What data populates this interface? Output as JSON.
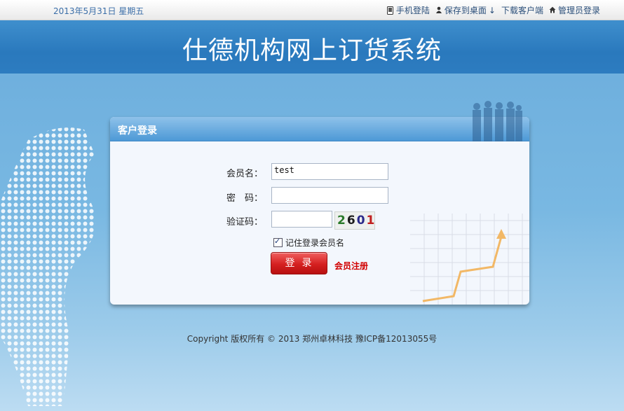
{
  "topbar": {
    "date": "2013年5月31日  星期五",
    "links": {
      "mobile": "手机登陆",
      "save_desktop": "保存到桌面",
      "download_client": "下载客户端",
      "admin_login": "管理员登录"
    }
  },
  "header": {
    "title": "仕德机构网上订货系统"
  },
  "login": {
    "panel_title": "客户登录",
    "username_label": "会员名：",
    "username_value": "test",
    "password_label": "密　码：",
    "password_value": "",
    "captcha_label": "验证码：",
    "captcha_value": "",
    "captcha_digits": [
      "2",
      "6",
      "0",
      "1"
    ],
    "captcha_colors": [
      "#2a7a2a",
      "#1a1a1a",
      "#2a2a8a",
      "#c02020"
    ],
    "remember_label": "记住登录会员名",
    "remember_checked": true,
    "login_button": "登录",
    "register_link": "会员注册"
  },
  "footer": {
    "copyright": "Copyright  版权所有  © 2013  郑州卓林科技   豫ICP备12013055号"
  },
  "colors": {
    "header_bg": "#2a79bd",
    "accent_red": "#d52020",
    "register_red": "#d10000"
  }
}
